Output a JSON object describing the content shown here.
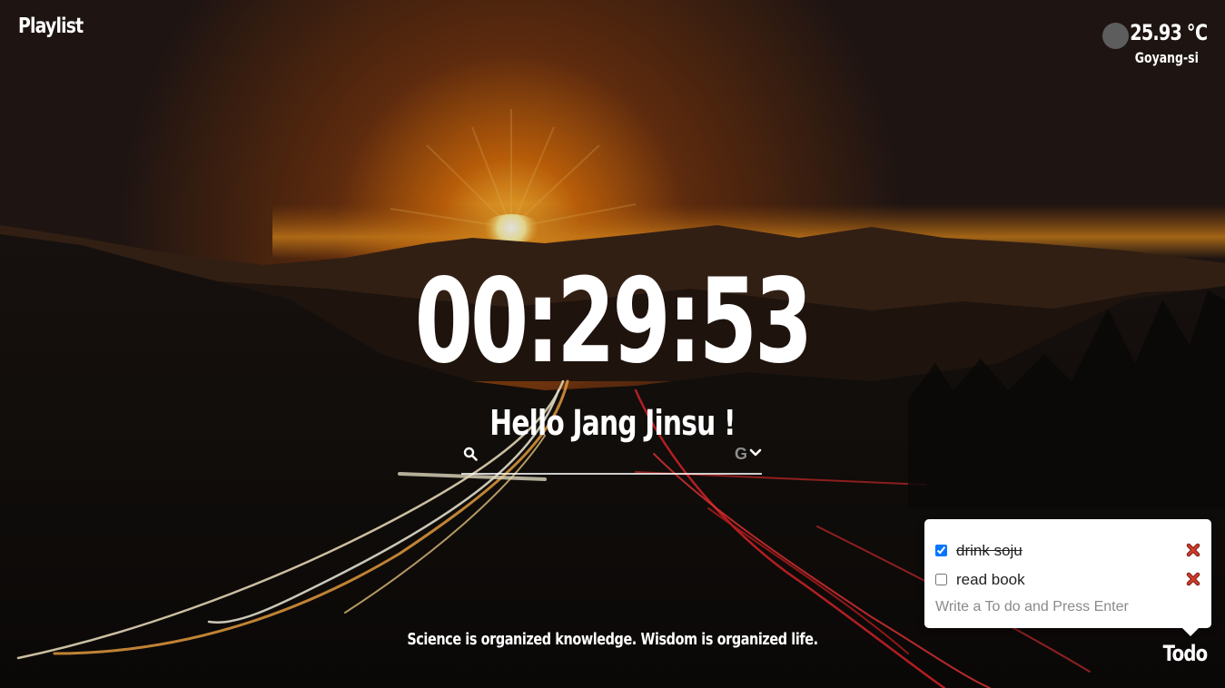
{
  "header": {
    "playlist_label": "Playlist"
  },
  "weather": {
    "temperature": "25.93 ℃",
    "city": "Goyang-si",
    "icon": "weather-icon"
  },
  "clock": {
    "time": "00:29:53"
  },
  "greeting": {
    "text": "Hello Jang Jinsu !"
  },
  "search": {
    "icon": "search-icon",
    "value": "",
    "engine_label": "G",
    "engine_icon": "chevron-down-icon"
  },
  "quote": {
    "text": "Science is organized knowledge. Wisdom is organized life."
  },
  "todo": {
    "toggle_label": "Todo",
    "items": [
      {
        "text": "drink soju",
        "done": true
      },
      {
        "text": "read book",
        "done": false
      }
    ],
    "input_placeholder": "Write a To do and Press Enter",
    "delete_icon": "close-icon",
    "delete_color": "#c0392b"
  },
  "colors": {
    "text": "#ffffff",
    "sun": "#ffb22e",
    "sky": "#2a1d16",
    "engine": "#8d8d8d"
  }
}
